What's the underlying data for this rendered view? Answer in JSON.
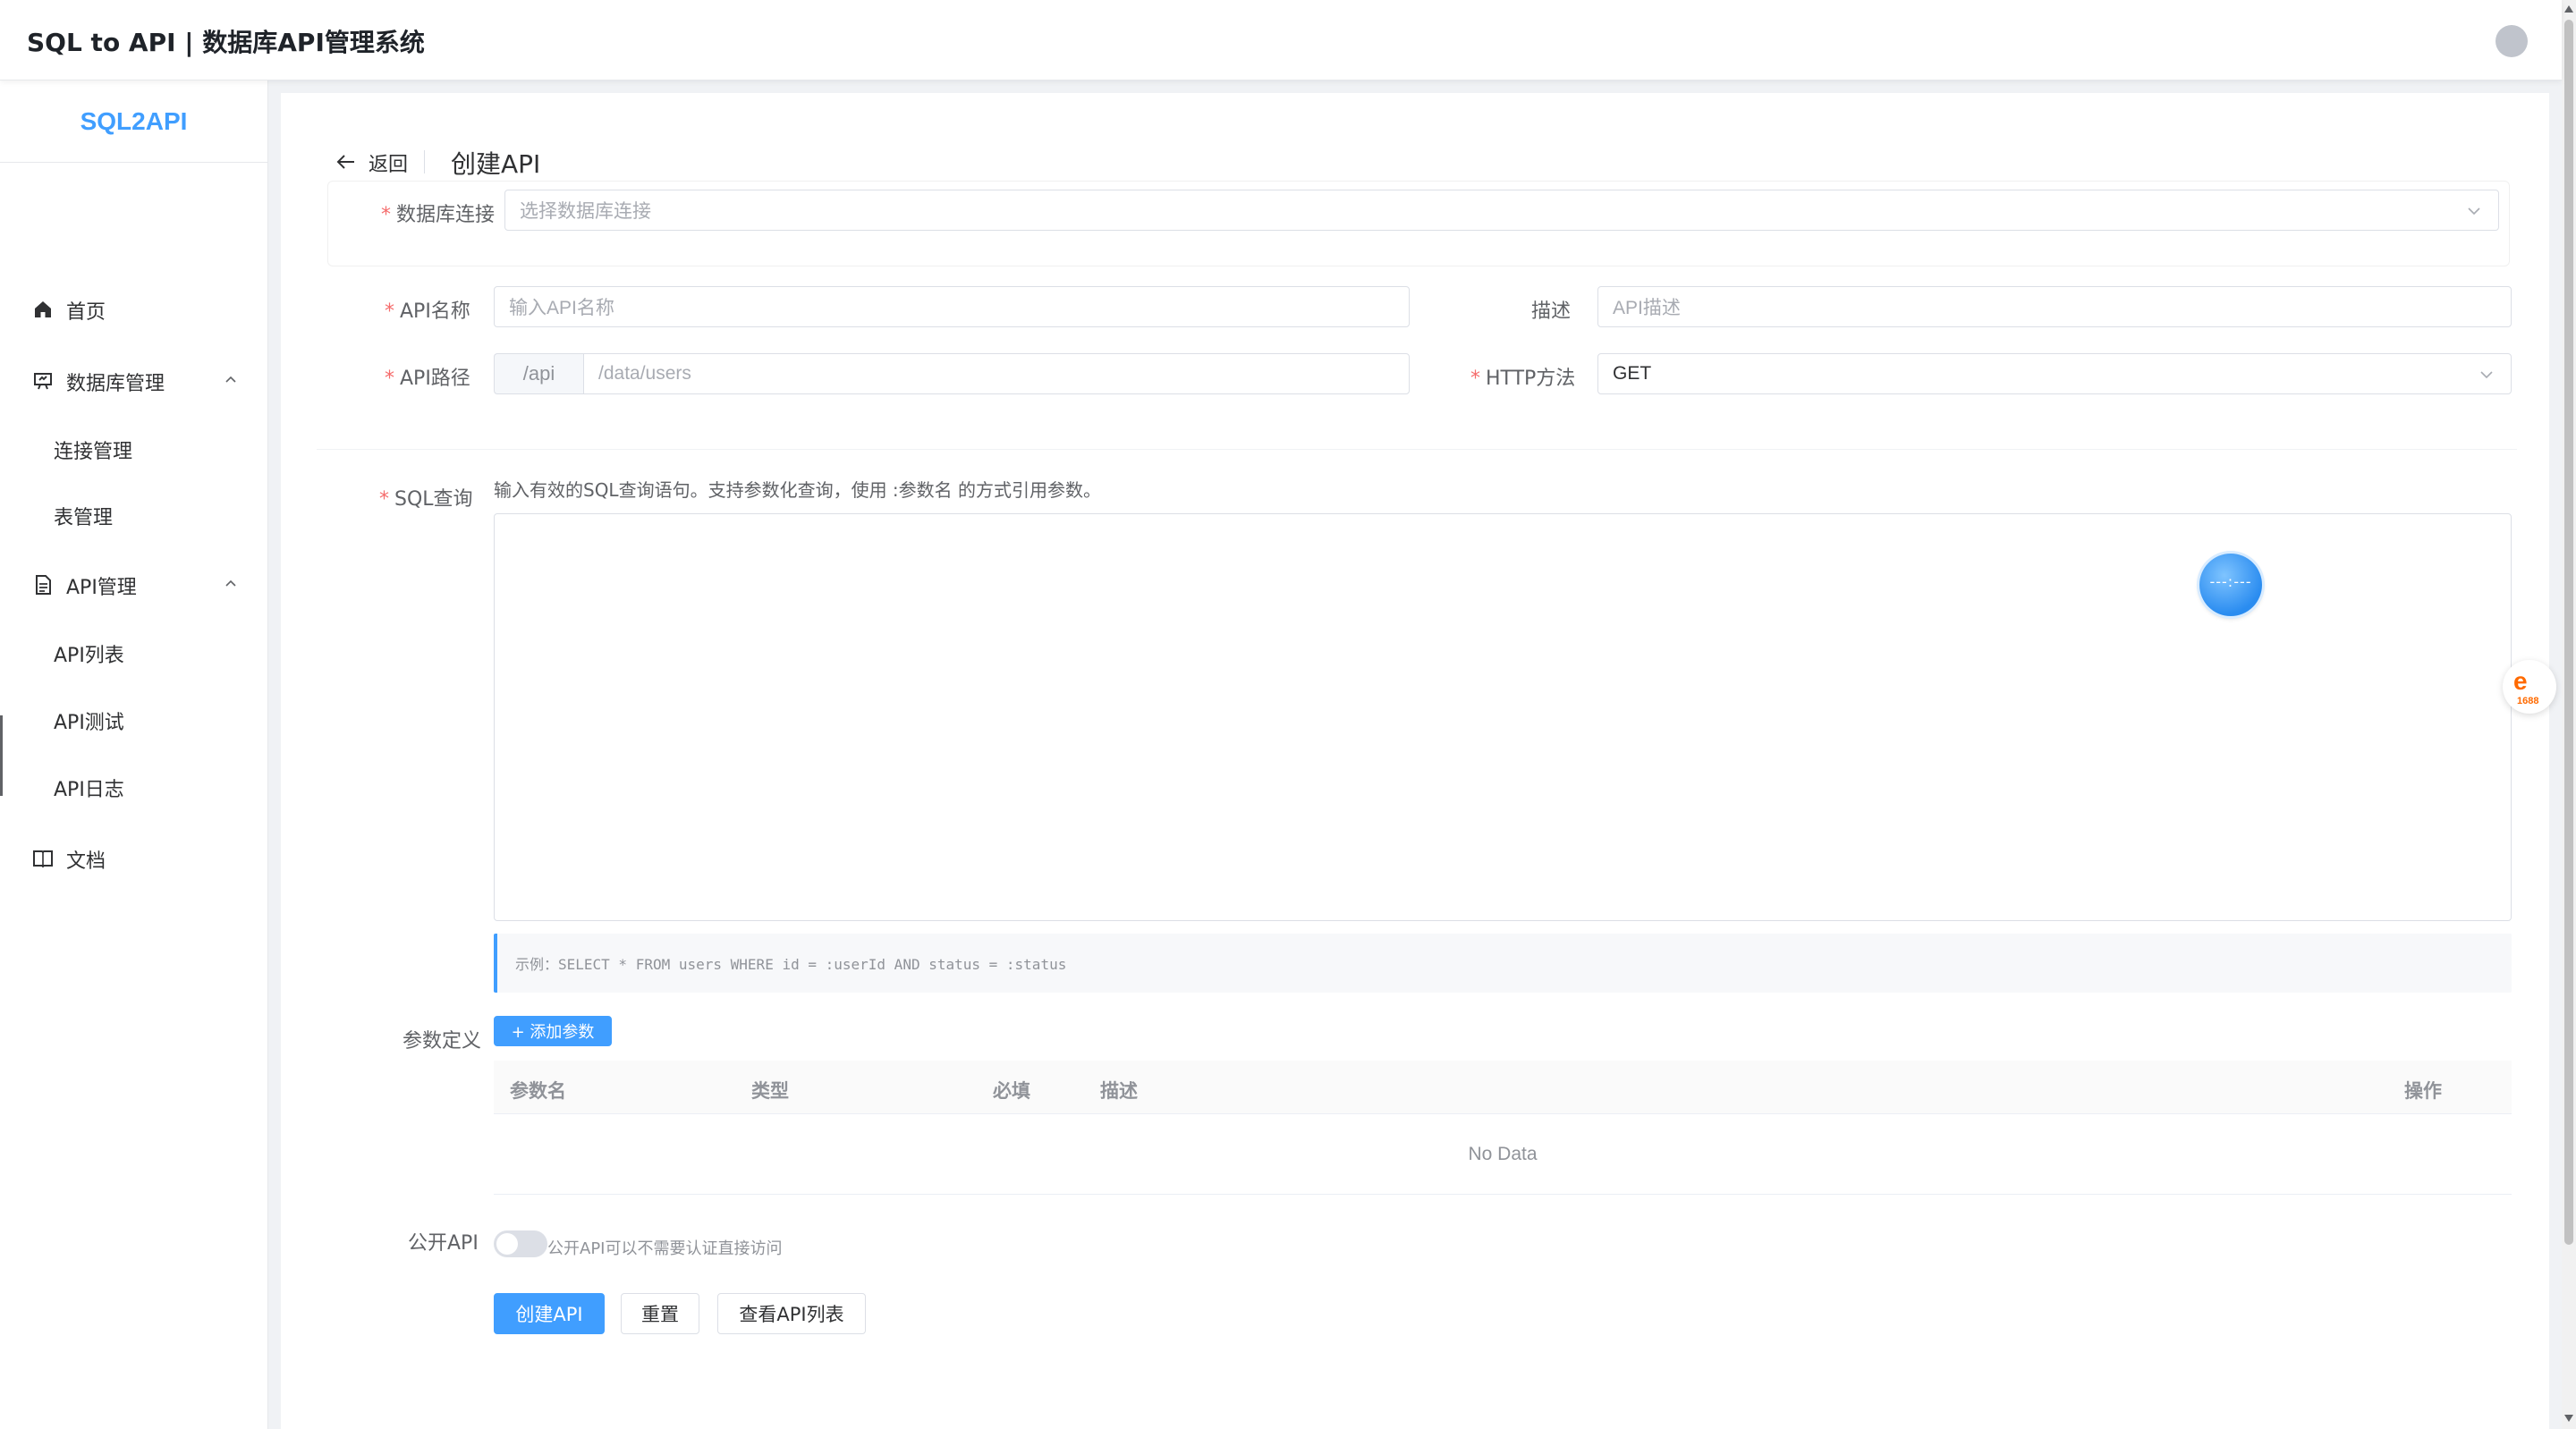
{
  "header": {
    "title": "SQL to API | 数据库API管理系统"
  },
  "sidebar": {
    "logo": "SQL2API",
    "items": [
      {
        "label": "首页",
        "icon": "home-icon"
      },
      {
        "label": "数据库管理",
        "icon": "presentation-icon",
        "expanded": true
      },
      {
        "label": "连接管理"
      },
      {
        "label": "表管理"
      },
      {
        "label": "API管理",
        "icon": "document-icon",
        "expanded": true
      },
      {
        "label": "API列表"
      },
      {
        "label": "API测试"
      },
      {
        "label": "API日志"
      },
      {
        "label": "文档",
        "icon": "book-icon"
      }
    ]
  },
  "page": {
    "back_label": "返回",
    "title": "创建API"
  },
  "form": {
    "db_connection": {
      "label": "数据库连接",
      "placeholder": "选择数据库连接"
    },
    "api_name": {
      "label": "API名称",
      "placeholder": "输入API名称"
    },
    "description": {
      "label": "描述",
      "placeholder": "API描述"
    },
    "api_path": {
      "label": "API路径",
      "prefix": "/api",
      "placeholder": "/data/users"
    },
    "http_method": {
      "label": "HTTP方法",
      "value": "GET"
    },
    "sql": {
      "label": "SQL查询",
      "hint": "输入有效的SQL查询语句。支持参数化查询，使用 :参数名 的方式引用参数。",
      "example": "示例：SELECT * FROM users WHERE id = :userId AND status = :status"
    },
    "params": {
      "label": "参数定义",
      "add_button": "+ 添加参数",
      "columns": [
        "参数名",
        "类型",
        "必填",
        "描述",
        "操作"
      ],
      "empty_text": "No Data"
    },
    "public_api": {
      "label": "公开API",
      "enabled": false,
      "hint": "公开API可以不需要认证直接访问"
    },
    "buttons": {
      "create": "创建API",
      "reset": "重置",
      "view_list": "查看API列表"
    }
  },
  "overlay": {
    "loader_text": "---:---",
    "badge_brand": "1688"
  },
  "colors": {
    "primary": "#409eff",
    "required": "#f56c6c",
    "badge": "#ff6a00"
  }
}
